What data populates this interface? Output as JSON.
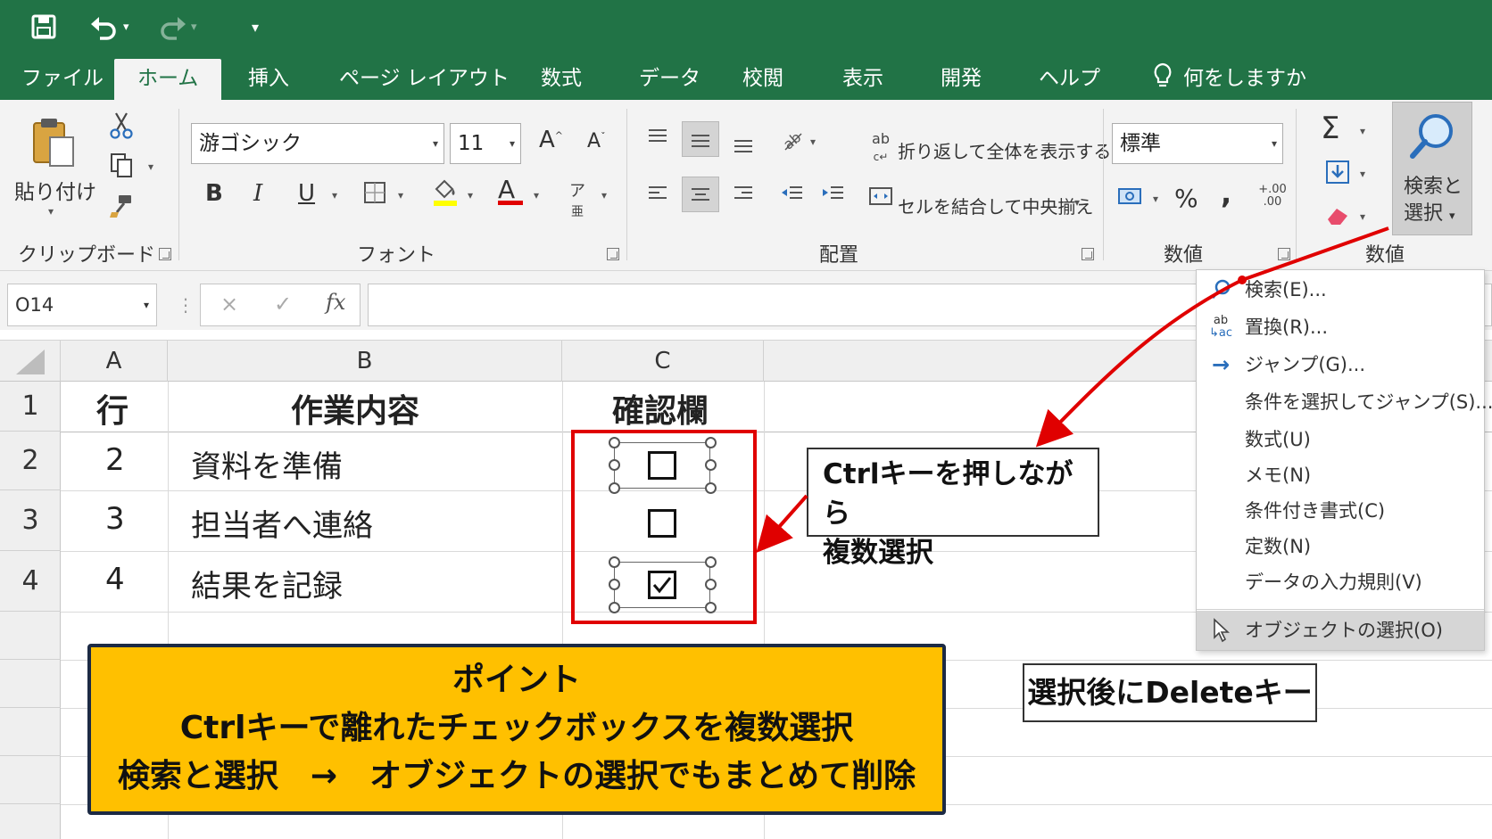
{
  "qat": {
    "save_icon": "save-icon",
    "undo_icon": "undo-icon",
    "redo_icon": "redo-icon",
    "customize_icon": "chevron-down-icon"
  },
  "tabs": [
    {
      "label": "ファイル"
    },
    {
      "label": "ホーム",
      "active": true
    },
    {
      "label": "挿入"
    },
    {
      "label": "ページ レイアウト"
    },
    {
      "label": "数式"
    },
    {
      "label": "データ"
    },
    {
      "label": "校閲"
    },
    {
      "label": "表示"
    },
    {
      "label": "開発"
    },
    {
      "label": "ヘルプ"
    }
  ],
  "tell_me": "何をしますか",
  "ribbon": {
    "clipboard": {
      "paste_label": "貼り付け",
      "group_label": "クリップボード"
    },
    "font": {
      "font_name": "游ゴシック",
      "font_size": "11",
      "group_label": "フォント",
      "bold": "B",
      "italic": "I",
      "underline": "U",
      "grow": "A",
      "shrink": "A",
      "color": "A",
      "font_color_hex": "#e00000",
      "highlight_hex": "#ffff00"
    },
    "alignment": {
      "wrap_text": "折り返して全体を表示する",
      "merge_center": "セルを結合して中央揃え",
      "group_label": "配置"
    },
    "number": {
      "format": "標準",
      "group_label": "数値",
      "percent": "%",
      "comma": ","
    },
    "editing": {
      "find_select_line1": "検索と",
      "find_select_line2": "選択",
      "group_label": "数値",
      "sum": "Σ"
    }
  },
  "formula_bar": {
    "name_box": "O14",
    "fx": "fx",
    "cancel": "×",
    "enter": "✓",
    "value": ""
  },
  "sheet": {
    "columns": [
      "A",
      "B",
      "C"
    ],
    "rows": [
      "1",
      "2",
      "3",
      "4"
    ],
    "header": {
      "a": "行",
      "b": "作業内容",
      "c": "確認欄"
    },
    "data": [
      {
        "a": "2",
        "b": "資料を準備",
        "checked": false,
        "selected": true
      },
      {
        "a": "3",
        "b": "担当者へ連絡",
        "checked": false,
        "selected": false
      },
      {
        "a": "4",
        "b": "結果を記録",
        "checked": true,
        "selected": true
      }
    ]
  },
  "menu": {
    "items": [
      {
        "label": "検索(E)...",
        "icon": "magnifier-icon"
      },
      {
        "label": "置換(R)...",
        "icon": "replace-icon"
      },
      {
        "label": "ジャンプ(G)...",
        "icon": "arrow-right-icon"
      },
      {
        "label": "条件を選択してジャンプ(S)..."
      },
      {
        "label": "数式(U)"
      },
      {
        "label": "メモ(N)"
      },
      {
        "label": "条件付き書式(C)"
      },
      {
        "label": "定数(N)"
      },
      {
        "label": "データの入力規則(V)"
      },
      {
        "label": "オブジェクトの選択(O)",
        "icon": "cursor-arrow-icon",
        "highlighted": true
      }
    ]
  },
  "callouts": {
    "ctrl_line1": "Ctrlキーを押しながら",
    "ctrl_line2": "複数選択",
    "after_select": "選択後にDeleteキー",
    "point_title": "ポイント",
    "point_line1": "Ctrlキーで離れたチェックボックスを複数選択",
    "point_line2": "検索と選択　→　オブジェクトの選択でもまとめて削除"
  },
  "colors": {
    "excel_green": "#217346",
    "annotation_red": "#e00000",
    "point_bg": "#ffc000",
    "point_border": "#1c2a44"
  }
}
